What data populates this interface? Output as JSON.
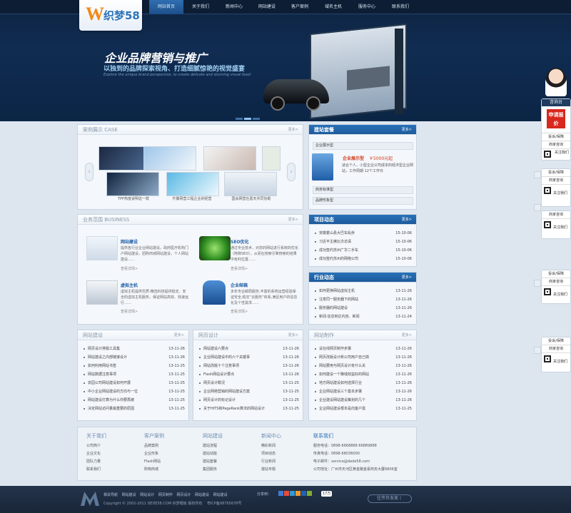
{
  "logo": {
    "mark": "W",
    "text": "织梦58"
  },
  "nav": [
    "网站首页",
    "关于我们",
    "新闻中心",
    "网站建设",
    "客户案例",
    "域名主机",
    "服务中心",
    "联系我们"
  ],
  "banner": {
    "title": "企业品牌营销与推广",
    "subtitle": "以独到的品牌探索视角、打造细腻惊艳的视觉盛宴",
    "english": "Explore the unique brand perspective, to create delicate and stunning visual feast"
  },
  "case": {
    "title": "案例展示 CASE",
    "more": "更多>",
    "captions": [
      "TPP热度说明这一款",
      "升翼网营工程企业的经营",
      "国会网营在嘉天共同协助"
    ]
  },
  "business": {
    "title": "业务范围 BUSINESS",
    "more": "更多>",
    "items": [
      {
        "name": "网站建设",
        "desc": "提供各行业企业网站建设，政府医疗机构门户网站建设，团购商城网站建设，个人网站建设……",
        "link": "查看详情>"
      },
      {
        "name": "SEO优化",
        "desc": "通过专业技术，对您的网站进行系统的优化（简称SEO），从而在搜索引擎搜索的结果中有利位置……",
        "link": "查看详情>"
      },
      {
        "name": "虚拟主机",
        "desc": "虚拟主机提供优质·精选科技提供稳定、安全的虚拟主机服务，保证网站高效、快速运行……",
        "link": "查看详情>"
      },
      {
        "name": "企业邮箱",
        "desc": "多年专业邮局服务,丰富的系统运营经验保证安全,稳定“云服务”体系,满足用户的信息化及个性需求……",
        "link": "查看详情>"
      }
    ]
  },
  "package": {
    "title": "建站套餐",
    "more": "更多>",
    "items": [
      "企业展示型",
      "商务标准型",
      "品牌形象型"
    ],
    "featured": {
      "name": "企业展示型",
      "price": "￥5000元起",
      "desc": "适合个人、小型企业公司成本的经济型企业网站，工作周期 12个工作日"
    }
  },
  "project": {
    "title": "项目动态",
    "more": "更多>",
    "rows": [
      [
        "安徽霍山县大巴车乱侨",
        "15-10-06"
      ],
      [
        "习近平主席比次访请",
        "15-10-06"
      ],
      [
        "成功签约苏州广华二手车",
        "15-10-06"
      ],
      [
        "成功签约苏州的网络公司",
        "15-10-06"
      ]
    ]
  },
  "industry": {
    "title": "行业动态",
    "more": "更多>",
    "rows": [
      [
        "如何更换网站虚拟主机",
        "13-11-26"
      ],
      [
        "注意同一服务器下的网站",
        "13-11-26"
      ],
      [
        "服务器的网站建设",
        "13-11-26"
      ],
      [
        "新闻·信息到达内容、新闻",
        "13-11-24"
      ]
    ]
  },
  "web_build": {
    "title": "网站建设",
    "more": "更多>",
    "rows": [
      [
        "网页设计排版工具集",
        "13-11-26"
      ],
      [
        "网站建设之内部链接设计",
        "13-11-26"
      ],
      [
        "如何利用网站书签",
        "13-11-25"
      ],
      [
        "网站数据注意事项",
        "13-11-25"
      ],
      [
        "袁园公司网站建设如何开展",
        "13-11-25"
      ],
      [
        "中小企业网站建设的方向与一位",
        "13-11-25"
      ],
      [
        "网站建设打算为什么你要再被",
        "13-11-25"
      ],
      [
        "决定网站访问量最重要的原因",
        "13-11-25"
      ]
    ]
  },
  "web_design": {
    "title": "网页设计",
    "more": "更多>",
    "rows": [
      [
        "网站建设六要点",
        "13-11-26"
      ],
      [
        "企业网站建设中的六个关键事",
        "13-11-26"
      ],
      [
        "网站改版十个注意事项",
        "13-11-26"
      ],
      [
        "Flash网站设计要点",
        "13-11-26"
      ],
      [
        "网页设计概况",
        "13-11-25"
      ],
      [
        "企业网络营销的网站建设方案",
        "13-11-25"
      ],
      [
        "网页设计的标记设计",
        "13-11-25"
      ],
      [
        "关于HITS和PageRank算法的网站设计",
        "13-11-25"
      ]
    ]
  },
  "web_make": {
    "title": "网站制作",
    "more": "更多>",
    "rows": [
      [
        "设在线网页制作步骤",
        "13-11-26"
      ],
      [
        "网页改版设计新公司用户自己搞",
        "13-11-26"
      ],
      [
        "网站要用与网页设计有什么关",
        "13-11-26"
      ],
      [
        "如何建设一个赚钱效益好的网站",
        "13-11-26"
      ],
      [
        "地方网站建设如何选择行业",
        "13-11-26"
      ],
      [
        "企业网站建设三个基本步骤",
        "13-11-26"
      ],
      [
        "企业建设网站建设策划的几个",
        "13-11-26"
      ],
      [
        "企业网站建设根本是向客户需",
        "13-11-25"
      ]
    ]
  },
  "footer_cols": [
    {
      "title": "关于我们",
      "items": [
        "公司简介",
        "企业文化",
        "团队力量",
        "联系我们"
      ]
    },
    {
      "title": "客户案例",
      "items": [
        "品牌案例",
        "企业形象",
        "Flash网站",
        "购物商城"
      ]
    },
    {
      "title": "网站建设",
      "items": [
        "建站流程",
        "建站动能",
        "建站套餐",
        "集团服务"
      ]
    },
    {
      "title": "新闻中心",
      "items": [
        "精彩新闻",
        "项目动态",
        "行业新闻",
        "建站专题"
      ]
    }
  ],
  "contact": {
    "title": "联系我们",
    "lines": [
      "服务电话：0898-6668888 66889888",
      "传真电话：0898-68036000",
      "电子邮件：service@dede58.com",
      "公司地址：广州市天河区黄金路金豪商务大厦6806室"
    ]
  },
  "bottom": {
    "links": [
      "相关导航",
      "网站建设",
      "网站设计",
      "网页制作",
      "网页设计",
      "网站建设",
      "网站建设"
    ],
    "copyright": "Copyright © 2002-2011 DEDE58.COM 织梦模板 版权所有",
    "icp": "粤ICP备98765678号",
    "share": "分享到：",
    "count": "17万",
    "slogan": "往传世发美丨"
  },
  "sidebar": {
    "title": "咨询台",
    "quote": "申请报价",
    "items": [
      "投诉/保障",
      "商家咨询",
      "关注我们"
    ]
  }
}
